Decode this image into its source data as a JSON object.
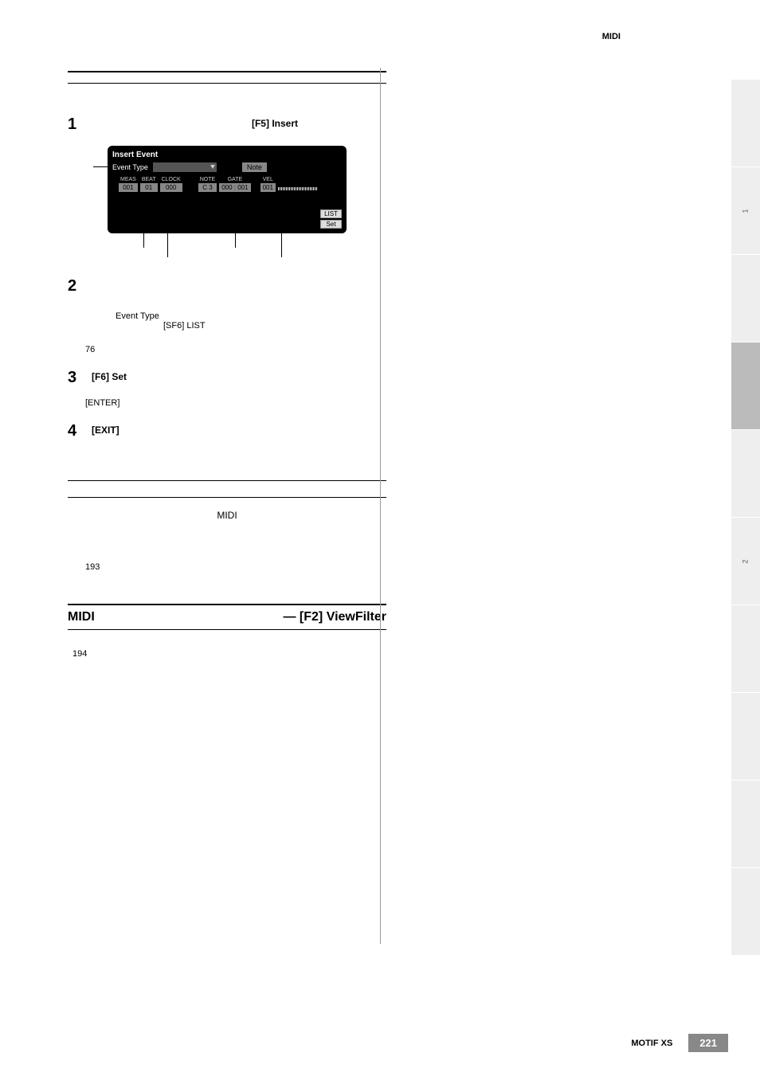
{
  "header": {
    "category": "MIDI"
  },
  "col1": {
    "step1": {
      "num": "1",
      "label_bold": "[F5] Insert"
    },
    "screenshot": {
      "title": "Insert Event",
      "event_type_label": "Event Type",
      "event_type_value": "Note",
      "cols": {
        "meas_h": "MEAS",
        "meas_v": "001",
        "beat_h": "BEAT",
        "beat_v": "01",
        "clock_h": "CLOCK",
        "clock_v": "000",
        "note_h": "NOTE",
        "note_v": "C 3",
        "gate_h": "GATE",
        "gate_v": "000 : 001",
        "vel_h": "VEL",
        "vel_v": "001"
      },
      "btn_list": "LIST",
      "btn_set": "Set"
    },
    "step2": {
      "num": "2",
      "body_a": "Event Type",
      "body_b": "[SF6] LIST",
      "note_ref": "76"
    },
    "step3": {
      "num": "3",
      "label_bold": "[F6] Set",
      "body": "[ENTER]"
    },
    "step4": {
      "num": "4",
      "label_bold": "[EXIT]"
    },
    "midsection": {
      "midi_word": "MIDI",
      "ref": "193"
    },
    "section": {
      "left": "MIDI",
      "right": "— [F2] ViewFilter"
    },
    "final_ref": "194"
  },
  "sidebar": {
    "n1": "1",
    "n2": "2"
  },
  "footer": {
    "product": "MOTIF XS",
    "page": "221"
  }
}
